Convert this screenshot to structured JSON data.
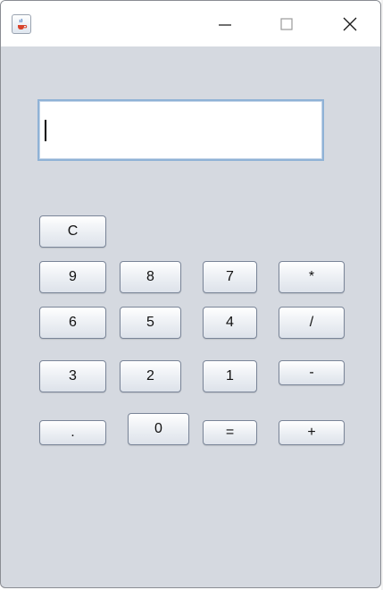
{
  "window": {
    "title_icon": "java-cup-icon",
    "controls": {
      "minimize_icon": "minimize-icon",
      "maximize_icon": "maximize-icon",
      "close_icon": "close-icon"
    }
  },
  "display": {
    "value": ""
  },
  "keys": {
    "clear": "C",
    "nine": "9",
    "eight": "8",
    "seven": "7",
    "multiply": "*",
    "six": "6",
    "five": "5",
    "four": "4",
    "divide": "/",
    "three": "3",
    "two": "2",
    "one": "1",
    "minus": "-",
    "dot": ".",
    "zero": "0",
    "equals": "=",
    "plus": "+"
  },
  "colors": {
    "background": "#d5d9e0",
    "display_border": "#8fb2d6",
    "button_border": "#7a8598"
  }
}
